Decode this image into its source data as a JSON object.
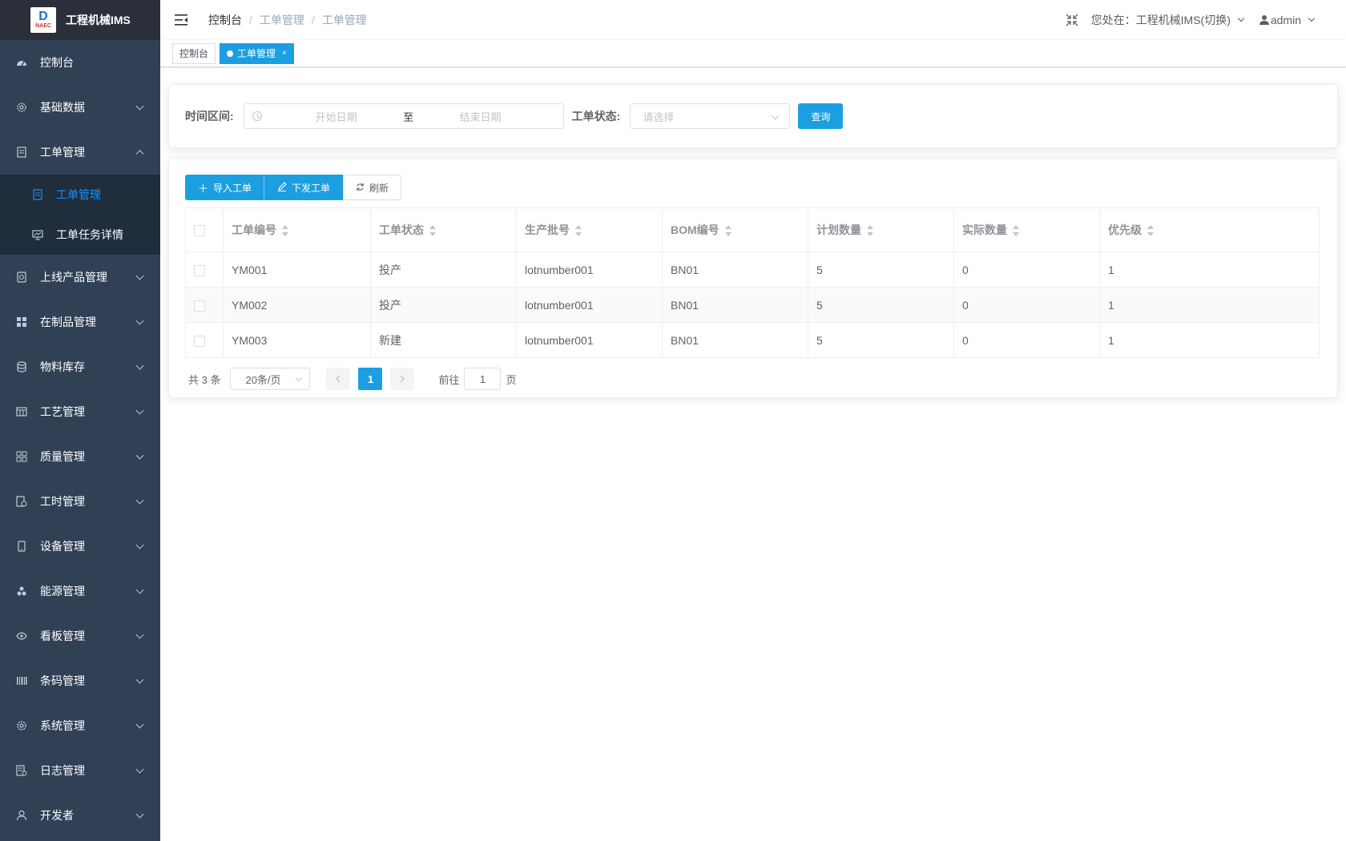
{
  "app": {
    "logo_mark": "D",
    "logo_sub": "NAEC",
    "title": "工程机械IMS"
  },
  "sidebar": {
    "items": [
      {
        "label": "控制台",
        "icon": "dashboard-icon"
      },
      {
        "label": "基础数据",
        "icon": "gear-icon"
      },
      {
        "label": "工单管理",
        "icon": "document-icon",
        "expanded": true,
        "children": [
          {
            "label": "工单管理",
            "icon": "document-icon",
            "active": true
          },
          {
            "label": "工单任务详情",
            "icon": "chart-icon"
          }
        ]
      },
      {
        "label": "上线产品管理",
        "icon": "box-icon"
      },
      {
        "label": "在制品管理",
        "icon": "grid-icon"
      },
      {
        "label": "物料库存",
        "icon": "database-icon"
      },
      {
        "label": "工艺管理",
        "icon": "table-icon"
      },
      {
        "label": "质量管理",
        "icon": "apps-icon"
      },
      {
        "label": "工时管理",
        "icon": "clock-doc-icon"
      },
      {
        "label": "设备管理",
        "icon": "mobile-icon"
      },
      {
        "label": "能源管理",
        "icon": "energy-icon"
      },
      {
        "label": "看板管理",
        "icon": "eye-icon"
      },
      {
        "label": "条码管理",
        "icon": "barcode-icon"
      },
      {
        "label": "系统管理",
        "icon": "gear-icon"
      },
      {
        "label": "日志管理",
        "icon": "log-icon"
      },
      {
        "label": "开发者",
        "icon": "user-icon"
      }
    ]
  },
  "header": {
    "breadcrumb": [
      "控制台",
      "工单管理",
      "工单管理"
    ],
    "location_label": "您处在：工程机械IMS(切换)",
    "user": "admin"
  },
  "tags": [
    {
      "label": "控制台",
      "active": false
    },
    {
      "label": "工单管理",
      "active": true,
      "close": "×"
    }
  ],
  "search": {
    "time_label": "时间区间:",
    "start_placeholder": "开始日期",
    "to": "至",
    "end_placeholder": "结束日期",
    "status_label": "工单状态:",
    "status_placeholder": "请选择",
    "query_button": "查询"
  },
  "toolbar": {
    "import": "导入工单",
    "dispatch": "下发工单",
    "refresh": "刷新"
  },
  "table": {
    "columns": [
      "工单编号",
      "工单状态",
      "生产批号",
      "BOM编号",
      "计划数量",
      "实际数量",
      "优先级"
    ],
    "rows": [
      [
        "YM001",
        "投产",
        "lotnumber001",
        "BN01",
        "5",
        "0",
        "1"
      ],
      [
        "YM002",
        "投产",
        "lotnumber001",
        "BN01",
        "5",
        "0",
        "1"
      ],
      [
        "YM003",
        "新建",
        "lotnumber001",
        "BN01",
        "5",
        "0",
        "1"
      ]
    ]
  },
  "pagination": {
    "total": "共 3 条",
    "page_size": "20条/页",
    "current": "1",
    "goto_label": "前往",
    "goto_value": "1",
    "page_suffix": "页"
  },
  "colors": {
    "sidebar_bg": "#304156",
    "submenu_bg": "#1f2d3d",
    "accent": "#1c9fe0",
    "active_menu_text": "#1890ff"
  }
}
